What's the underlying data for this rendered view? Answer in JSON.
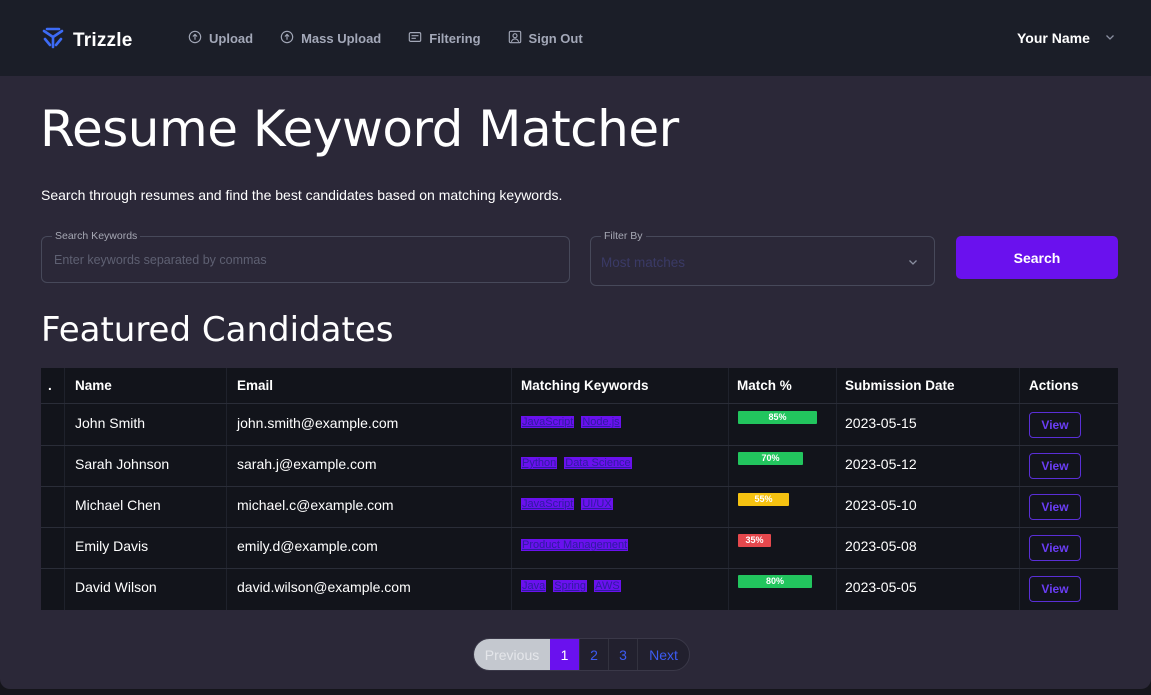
{
  "nav": {
    "brand": "Trizzle",
    "links": [
      {
        "label": "Upload",
        "icon": "upload-icon"
      },
      {
        "label": "Mass Upload",
        "icon": "upload-icon"
      },
      {
        "label": "Filtering",
        "icon": "filter-list-icon"
      },
      {
        "label": "Sign Out",
        "icon": "user-icon"
      }
    ],
    "user_name": "Your Name"
  },
  "page": {
    "title": "Resume Keyword Matcher",
    "subtitle": "Search through resumes and find the best candidates based on matching keywords."
  },
  "search": {
    "keywords_label": "Search Keywords",
    "keywords_placeholder": "Enter keywords separated by commas",
    "keywords_value": "",
    "filter_label": "Filter By",
    "filter_value": "Most matches",
    "button_label": "Search"
  },
  "featured": {
    "heading": "Featured Candidates",
    "columns": [
      ".",
      "Name",
      "Email",
      "Matching Keywords",
      "Match %",
      "Submission Date",
      "Actions"
    ],
    "rows": [
      {
        "name": "John Smith",
        "email": "john.smith@example.com",
        "keywords": [
          "JavaScript",
          "Node.js"
        ],
        "match": "85%",
        "match_pct": 85,
        "match_color": "#22c55e",
        "date": "2023-05-15",
        "action": "View"
      },
      {
        "name": "Sarah Johnson",
        "email": "sarah.j@example.com",
        "keywords": [
          "Python",
          "Data Science"
        ],
        "match": "70%",
        "match_pct": 70,
        "match_color": "#22c55e",
        "date": "2023-05-12",
        "action": "View"
      },
      {
        "name": "Michael Chen",
        "email": "michael.c@example.com",
        "keywords": [
          "JavaScript",
          "UI/UX"
        ],
        "match": "55%",
        "match_pct": 55,
        "match_color": "#f5c211",
        "date": "2023-05-10",
        "action": "View"
      },
      {
        "name": "Emily Davis",
        "email": "emily.d@example.com",
        "keywords": [
          "Product Management"
        ],
        "match": "35%",
        "match_pct": 35,
        "match_color": "#e5484d",
        "date": "2023-05-08",
        "action": "View"
      },
      {
        "name": "David Wilson",
        "email": "david.wilson@example.com",
        "keywords": [
          "Java",
          "Spring",
          "AWS"
        ],
        "match": "80%",
        "match_pct": 80,
        "match_color": "#22c55e",
        "date": "2023-05-05",
        "action": "View"
      }
    ]
  },
  "pagination": {
    "previous": "Previous",
    "pages": [
      "1",
      "2",
      "3"
    ],
    "current": "1",
    "next": "Next"
  },
  "colors": {
    "accent": "#6a11ee",
    "background": "#2b2838",
    "navbar": "#1b1e28",
    "table": "#12141b"
  }
}
